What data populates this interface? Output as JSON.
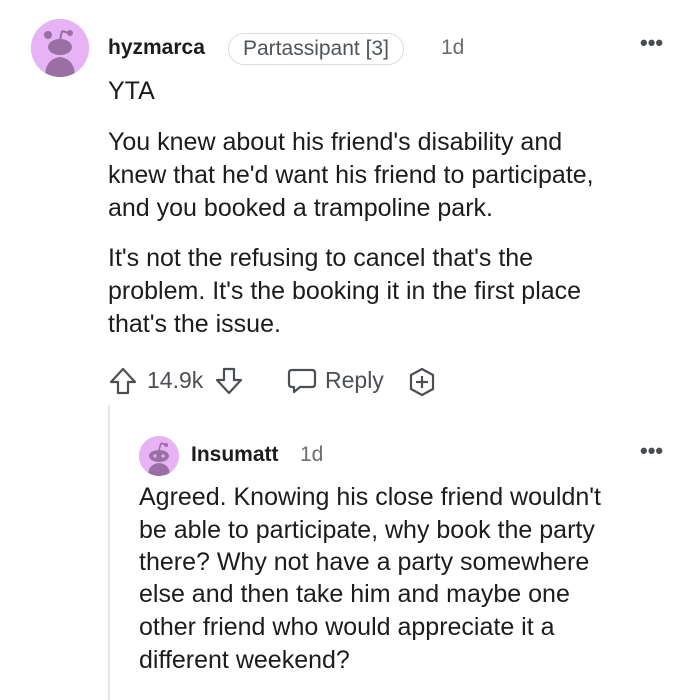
{
  "comment": {
    "username": "hyzmarca",
    "flair": "Partassipant [3]",
    "time": "1d",
    "more_icon": "ellipsis-icon",
    "avatar": "reddit-snoo-avatar",
    "avatar_color": "#e7b3f5",
    "verdict": "YTA",
    "paragraph1": [
      "You knew about his friend's disability and",
      "knew that he'd want his friend to participate,",
      "and you booked a trampoline park."
    ],
    "paragraph2": [
      "It's not the refusing to cancel that's the",
      "problem. It's the booking it in the first place",
      "that's the issue."
    ],
    "actions": {
      "upvote_icon": "upvote-arrow-icon",
      "score": "14.9k",
      "downvote_icon": "downvote-arrow-icon",
      "reply_icon": "speech-bubble-icon",
      "reply_label": "Reply",
      "award_icon": "award-plus-icon"
    }
  },
  "reply": {
    "username": "Insumatt",
    "time": "1d",
    "more_icon": "ellipsis-icon",
    "avatar": "reddit-snoo-avatar",
    "lines": [
      "Agreed. Knowing his close friend wouldn't",
      "be able to participate, why book the party",
      "there? Why not have a party somewhere",
      "else and then take him and maybe one",
      "other friend who would appreciate it a",
      "different weekend?"
    ]
  }
}
